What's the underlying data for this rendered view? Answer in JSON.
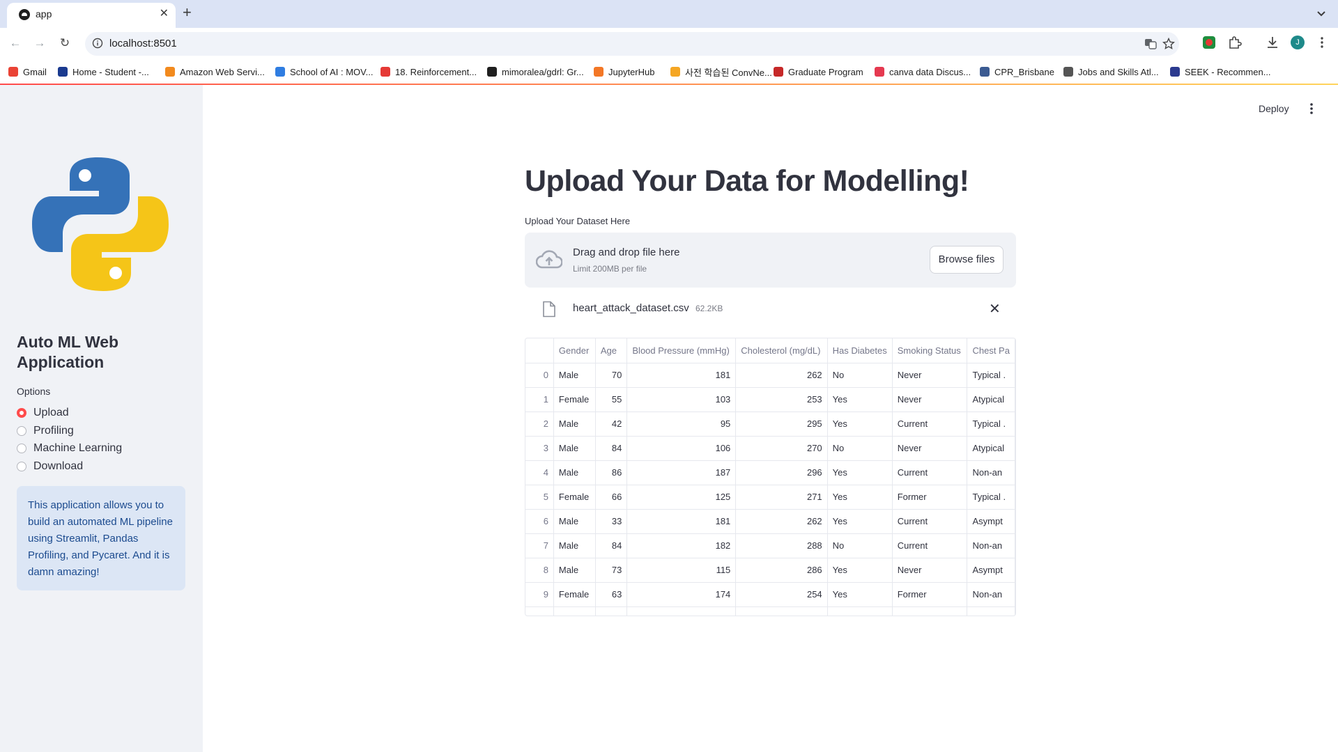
{
  "browser": {
    "tab_title": "app",
    "url": "localhost:8501",
    "bookmarks": [
      {
        "label": "Gmail",
        "color": "#ea4335"
      },
      {
        "label": "Home - Student -...",
        "color": "#1a3a8f"
      },
      {
        "label": "Amazon Web Servi...",
        "color": "#f28a1e"
      },
      {
        "label": "School of AI : MOV...",
        "color": "#2f7de1"
      },
      {
        "label": "18. Reinforcement...",
        "color": "#e53935"
      },
      {
        "label": "mimoralea/gdrl: Gr...",
        "color": "#1f1f1f"
      },
      {
        "label": "JupyterHub",
        "color": "#f37726"
      },
      {
        "label": "사전 학습된 ConvNe...",
        "color": "#f5a623"
      },
      {
        "label": "Graduate Program",
        "color": "#c62828"
      },
      {
        "label": "canva data Discus...",
        "color": "#e53950"
      },
      {
        "label": "CPR_Brisbane",
        "color": "#3b5b92"
      },
      {
        "label": "Jobs and Skills Atl...",
        "color": "#555555"
      },
      {
        "label": "SEEK - Recommen...",
        "color": "#2b3a8f"
      }
    ]
  },
  "sidebar": {
    "title": "Auto ML Web Application",
    "options_label": "Options",
    "options": [
      "Upload",
      "Profiling",
      "Machine Learning",
      "Download"
    ],
    "selected": "Upload",
    "info": "This application allows you to build an automated ML pipeline using Streamlit, Pandas Profiling, and Pycaret. And it is damn amazing!"
  },
  "header": {
    "deploy_label": "Deploy"
  },
  "main": {
    "title": "Upload Your Data for Modelling!",
    "upload_label": "Upload Your Dataset Here",
    "dropzone_title": "Drag and drop file here",
    "dropzone_limit": "Limit 200MB per file",
    "browse_label": "Browse files",
    "file_name": "heart_attack_dataset.csv",
    "file_size": "62.2KB"
  },
  "table": {
    "columns": [
      "",
      "Gender",
      "Age",
      "Blood Pressure (mmHg)",
      "Cholesterol (mg/dL)",
      "Has Diabetes",
      "Smoking Status",
      "Chest Pa"
    ],
    "rows": [
      [
        "0",
        "Male",
        "70",
        "181",
        "262",
        "No",
        "Never",
        "Typical ."
      ],
      [
        "1",
        "Female",
        "55",
        "103",
        "253",
        "Yes",
        "Never",
        "Atypical"
      ],
      [
        "2",
        "Male",
        "42",
        "95",
        "295",
        "Yes",
        "Current",
        "Typical ."
      ],
      [
        "3",
        "Male",
        "84",
        "106",
        "270",
        "No",
        "Never",
        "Atypical"
      ],
      [
        "4",
        "Male",
        "86",
        "187",
        "296",
        "Yes",
        "Current",
        "Non-an"
      ],
      [
        "5",
        "Female",
        "66",
        "125",
        "271",
        "Yes",
        "Former",
        "Typical ."
      ],
      [
        "6",
        "Male",
        "33",
        "181",
        "262",
        "Yes",
        "Current",
        "Asympt"
      ],
      [
        "7",
        "Male",
        "84",
        "182",
        "288",
        "No",
        "Current",
        "Non-an"
      ],
      [
        "8",
        "Male",
        "73",
        "115",
        "286",
        "Yes",
        "Never",
        "Asympt"
      ],
      [
        "9",
        "Female",
        "63",
        "174",
        "254",
        "Yes",
        "Former",
        "Non-an"
      ]
    ]
  }
}
